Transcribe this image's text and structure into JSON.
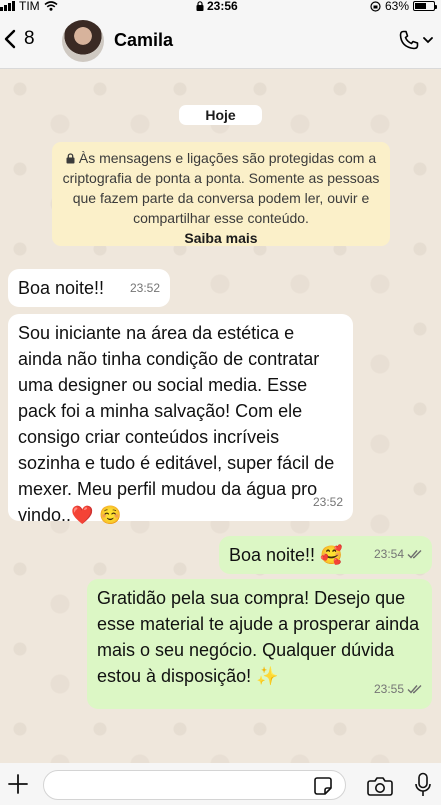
{
  "status_bar": {
    "carrier": "TIM",
    "time": "23:56",
    "battery": "63%",
    "battery_level": 0.63
  },
  "header": {
    "back_count": "8",
    "contact_name": "Camila"
  },
  "chat": {
    "date_chip": "Hoje",
    "encryption_notice": "Às mensagens e ligações são protegidas com a criptografia de ponta a ponta. Somente as pessoas que fazem parte da conversa podem ler, ouvir e compartilhar esse conteúdo.",
    "encryption_more": "Saiba mais",
    "messages": [
      {
        "direction": "in",
        "text": "Boa noite!!",
        "time": "23:52"
      },
      {
        "direction": "in",
        "text": "Sou iniciante na área da estética e ainda não tinha condição de contratar uma designer ou social media. Esse pack foi a minha salvação! Com ele consigo criar conteúdos incríveis sozinha e tudo é editável, super fácil de mexer. Meu perfil mudou da água pro vindo..",
        "emoji": "❤️ ☺️",
        "time": "23:52"
      },
      {
        "direction": "out",
        "text": "Boa noite!!",
        "emoji": "🥰",
        "time": "23:54"
      },
      {
        "direction": "out",
        "text": "Gratidão pela sua compra! Desejo que esse material te ajude a prosperar ainda mais o seu negócio. Qualquer dúvida estou à disposição!",
        "emoji": "✨",
        "time": "23:55"
      }
    ]
  },
  "input_bar": {
    "placeholder": ""
  },
  "icons": {
    "back": "chevron-left-icon",
    "call": "phone-icon",
    "dropdown": "chevron-down-icon",
    "lock": "lock-icon",
    "read_receipt": "double-check-icon",
    "plus": "plus-icon",
    "sticker": "sticker-icon",
    "camera": "camera-icon",
    "mic": "microphone-icon"
  },
  "colors": {
    "outgoing_bubble": "#dcf7c5",
    "incoming_bubble": "#ffffff",
    "notice_background": "#fbf0c9",
    "chat_background": "#efe7dc",
    "read_receipt": "#6e6e6e"
  }
}
